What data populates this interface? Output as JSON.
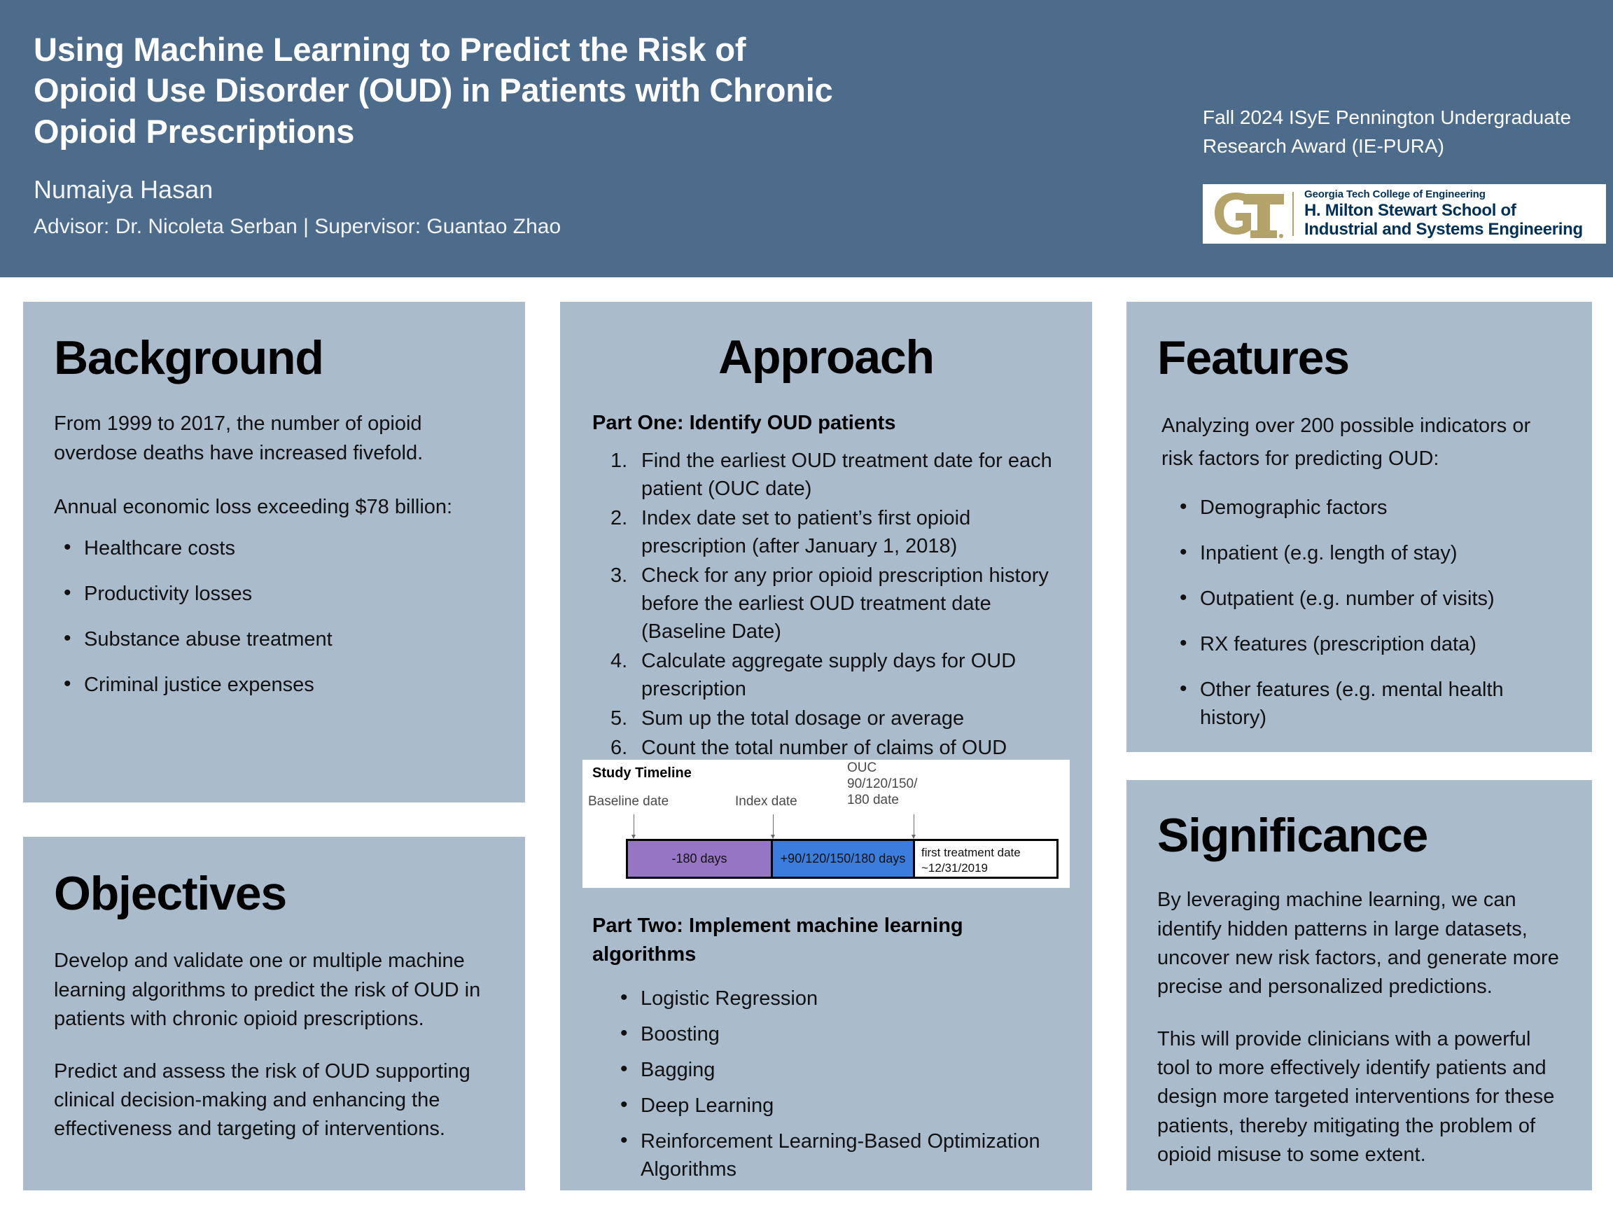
{
  "header": {
    "title_lines": [
      "Using Machine Learning to Predict the Risk of",
      "Opioid Use Disorder (OUD) in Patients with Chronic",
      "Opioid Prescriptions"
    ],
    "author": "Numaiya Hasan",
    "advisor_line": "Advisor: Dr. Nicoleta Serban  |  Supervisor: Guantao Zhao",
    "award_lines": [
      "Fall 2024 ISyE Pennington Undergraduate",
      "Research Award (IE-PURA)"
    ],
    "band_color": "#4d6b8a",
    "logo": {
      "mark_text": "GT",
      "mark_color": "#b3a369",
      "text_color": "#003057",
      "top_line": "Georgia Tech College of Engineering",
      "big_line_1": "H. Milton Stewart School of",
      "big_line_2": "Industrial and Systems Engineering"
    }
  },
  "panel_color": "#aabccc",
  "background": {
    "title": "Background",
    "para_1": "From 1999 to 2017, the number of opioid overdose deaths have increased fivefold.",
    "para_2": "Annual economic loss exceeding $78 billion:",
    "bullets": [
      "Healthcare costs",
      "Productivity losses",
      "Substance abuse treatment",
      "Criminal justice expenses"
    ]
  },
  "objectives": {
    "title": "Objectives",
    "para_1": "Develop and validate one or multiple machine learning algorithms to predict the risk of OUD in patients with chronic opioid prescriptions.",
    "para_2": "Predict and assess the risk of OUD supporting clinical decision-making and enhancing the effectiveness and targeting of interventions."
  },
  "approach": {
    "title": "Approach",
    "part_one_heading": "Part One: Identify OUD patients",
    "part_one_steps": [
      "Find the earliest OUD treatment date for each patient (OUC date)",
      "Index date set to patient’s first opioid prescription (after January 1, 2018)",
      "Check for any prior opioid prescription history before the earliest OUD treatment date (Baseline Date)",
      "Calculate aggregate supply days for OUD prescription",
      "Sum up the total dosage or average",
      "Count the total number of claims of OUD"
    ],
    "part_two_heading_line_1": "Part Two: Implement machine learning",
    "part_two_heading_line_2": "algorithms",
    "part_two_bullets": [
      "Logistic Regression",
      "Boosting",
      "Bagging",
      "Deep Learning",
      "Reinforcement Learning-Based Optimization Algorithms"
    ]
  },
  "timeline": {
    "title": "Study Timeline",
    "label_baseline": "Baseline date",
    "label_index": "Index date",
    "label_ouc_line_1": "OUC",
    "label_ouc_line_2": "90/120/150/",
    "label_ouc_line_3": "180 date",
    "segment_1_label": "-180 days",
    "segment_1_color": "#9575c4",
    "segment_2_label": "+90/120/150/180 days",
    "segment_2_color": "#3b7ddd",
    "segment_3_line_1": "first treatment date",
    "segment_3_line_2": "~12/31/2019",
    "segment_3_color": "#ffffff"
  },
  "features": {
    "title": "Features",
    "intro": "Analyzing over 200 possible indicators or risk factors for predicting OUD:",
    "bullets": [
      "Demographic factors",
      "Inpatient (e.g. length of stay)",
      "Outpatient (e.g. number of visits)",
      "RX features (prescription data)",
      "Other features (e.g. mental health history)"
    ]
  },
  "significance": {
    "title": "Significance",
    "para_1": "By leveraging machine learning, we can identify hidden patterns in large datasets, uncover new risk factors, and generate more precise and personalized predictions.",
    "para_2": "This will provide clinicians with a powerful tool to more effectively identify patients and design more targeted interventions for these patients, thereby mitigating the problem of opioid misuse to some extent."
  }
}
